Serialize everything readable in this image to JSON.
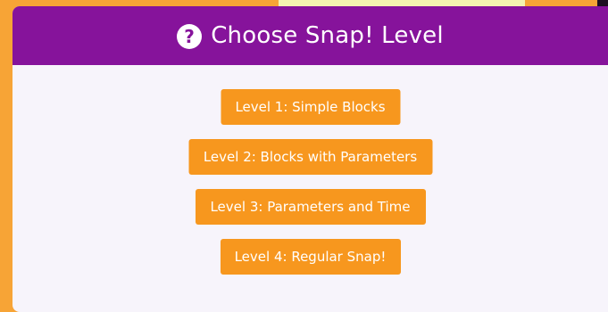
{
  "dialog": {
    "title": "Choose Snap! Level",
    "title_icon": "question-circle-icon"
  },
  "levels": [
    {
      "label": "Level 1: Simple Blocks"
    },
    {
      "label": "Level 2: Blocks with Parameters"
    },
    {
      "label": "Level 3: Parameters and Time"
    },
    {
      "label": "Level 4: Regular Snap!"
    }
  ],
  "colors": {
    "header": "#86139b",
    "button": "#f7971e",
    "background": "#f7a436",
    "dialog_body": "#f7f4fb"
  }
}
